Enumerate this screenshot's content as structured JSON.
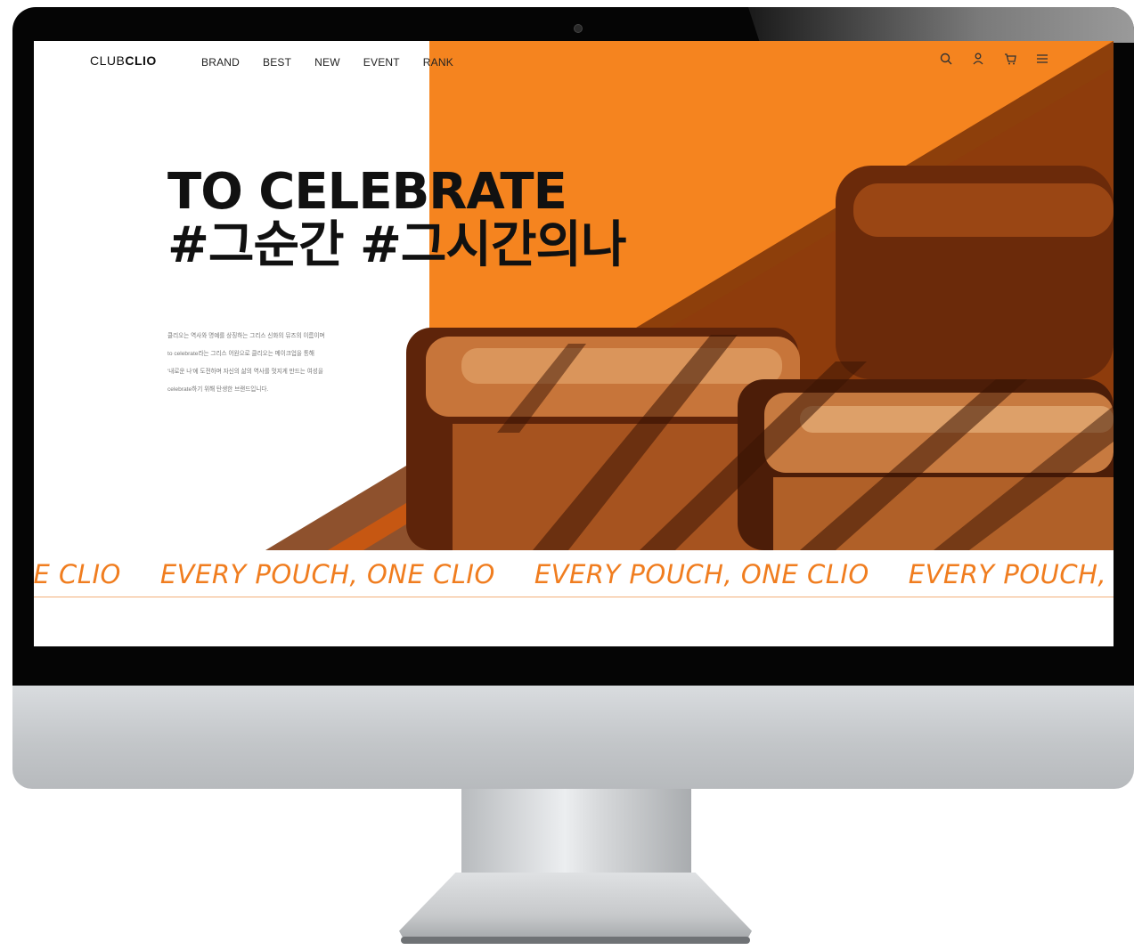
{
  "nav": {
    "logo_light": "CLUB",
    "logo_bold": "CLIO",
    "links": [
      "BRAND",
      "BEST",
      "NEW",
      "EVENT",
      "RANK"
    ],
    "icons": [
      "search-icon",
      "user-icon",
      "cart-icon",
      "menu-icon"
    ]
  },
  "hero": {
    "title_line1": "TO CELEBRATE",
    "title_line2": "#그순간 #그시간의나",
    "description": [
      "클리오는 역사와 명예를 상징하는 그리스 신화의 뮤즈의 이름이며",
      "to celebrate라는 그리스 어원으로 클리오는 메이크업을 통해",
      "'내로운 나'에 도전하며 자신의 삶의 역사를 멋지게 만드는 여성을",
      "celebrate하기 위해 탄생한 브랜드입니다."
    ]
  },
  "marquee": {
    "items": [
      "ONE CLIO",
      "EVERY POUCH, ONE CLIO",
      "EVERY POUCH, ONE CLIO",
      "EVERY POUCH, ONE CLIO"
    ]
  },
  "colors": {
    "accent": "#f5841f",
    "marquee_text": "#f07d1f",
    "bezel": "#050505"
  }
}
